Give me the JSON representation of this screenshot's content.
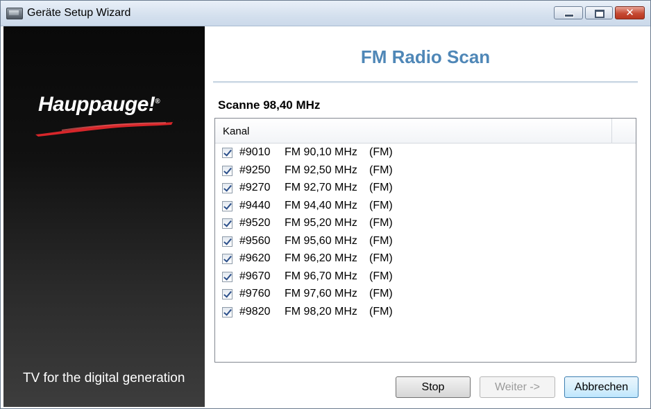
{
  "window": {
    "title": "Geräte Setup Wizard",
    "controls": {
      "min_icon": "minimize-icon",
      "max_icon": "maximize-icon",
      "close_icon": "close-icon",
      "close_glyph": "✕"
    }
  },
  "brand": {
    "logo": "Hauppauge!",
    "logo_mark": "®",
    "tagline": "TV for the digital generation"
  },
  "page": {
    "title": "FM Radio Scan",
    "status": "Scanne 98,40 MHz"
  },
  "list": {
    "header": "Kanal",
    "items": [
      {
        "checked": true,
        "id": "#9010",
        "freq": "FM 90,10 MHz",
        "type": "(FM)"
      },
      {
        "checked": true,
        "id": "#9250",
        "freq": "FM 92,50 MHz",
        "type": "(FM)"
      },
      {
        "checked": true,
        "id": "#9270",
        "freq": "FM 92,70 MHz",
        "type": "(FM)"
      },
      {
        "checked": true,
        "id": "#9440",
        "freq": "FM 94,40 MHz",
        "type": "(FM)"
      },
      {
        "checked": true,
        "id": "#9520",
        "freq": "FM 95,20 MHz",
        "type": "(FM)"
      },
      {
        "checked": true,
        "id": "#9560",
        "freq": "FM 95,60 MHz",
        "type": "(FM)"
      },
      {
        "checked": true,
        "id": "#9620",
        "freq": "FM 96,20 MHz",
        "type": "(FM)"
      },
      {
        "checked": true,
        "id": "#9670",
        "freq": "FM 96,70 MHz",
        "type": "(FM)"
      },
      {
        "checked": true,
        "id": "#9760",
        "freq": "FM 97,60 MHz",
        "type": "(FM)"
      },
      {
        "checked": true,
        "id": "#9820",
        "freq": "FM 98,20 MHz",
        "type": "(FM)"
      }
    ]
  },
  "buttons": {
    "stop": "Stop",
    "next": "Weiter ->",
    "next_enabled": false,
    "cancel": "Abbrechen"
  },
  "colors": {
    "title_accent": "#4f87b7",
    "swoosh": "#d7262a",
    "left_panel": "#111111"
  }
}
